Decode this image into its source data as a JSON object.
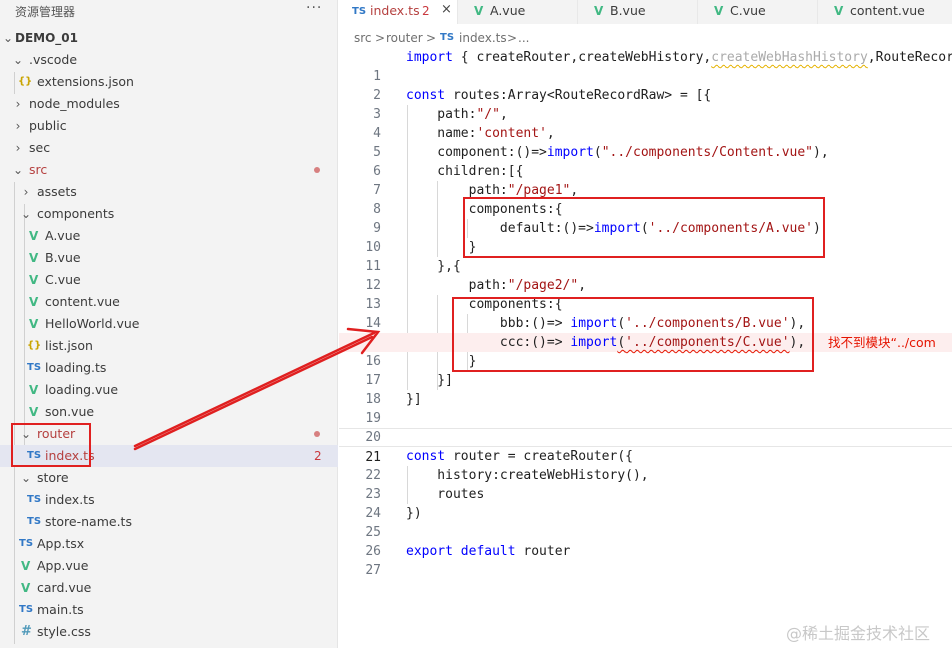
{
  "explorer": {
    "title": "资源管理器",
    "more": "···",
    "root": "DEMO_01",
    "items": [
      {
        "label": ".vscode",
        "kind": "folder-open"
      },
      {
        "label": "extensions.json",
        "kind": "json",
        "icon": "{}"
      },
      {
        "label": "node_modules",
        "kind": "folder"
      },
      {
        "label": "public",
        "kind": "folder"
      },
      {
        "label": "sec",
        "kind": "folder"
      },
      {
        "label": "src",
        "kind": "folder-open",
        "modified": true
      },
      {
        "label": "assets",
        "kind": "folder"
      },
      {
        "label": "components",
        "kind": "folder-open"
      },
      {
        "label": "A.vue",
        "kind": "vue",
        "icon": "V"
      },
      {
        "label": "B.vue",
        "kind": "vue",
        "icon": "V"
      },
      {
        "label": "C.vue",
        "kind": "vue",
        "icon": "V"
      },
      {
        "label": "content.vue",
        "kind": "vue",
        "icon": "V"
      },
      {
        "label": "HelloWorld.vue",
        "kind": "vue",
        "icon": "V"
      },
      {
        "label": "list.json",
        "kind": "json",
        "icon": "{}"
      },
      {
        "label": "loading.ts",
        "kind": "ts",
        "icon": "TS"
      },
      {
        "label": "loading.vue",
        "kind": "vue",
        "icon": "V"
      },
      {
        "label": "son.vue",
        "kind": "vue",
        "icon": "V"
      },
      {
        "label": "router",
        "kind": "folder-open",
        "modified": true
      },
      {
        "label": "index.ts",
        "kind": "ts",
        "icon": "TS",
        "badge": "2"
      },
      {
        "label": "store",
        "kind": "folder-open"
      },
      {
        "label": "index.ts",
        "kind": "ts",
        "icon": "TS"
      },
      {
        "label": "store-name.ts",
        "kind": "ts",
        "icon": "TS"
      },
      {
        "label": "App.tsx",
        "kind": "ts",
        "icon": "TS"
      },
      {
        "label": "App.vue",
        "kind": "vue",
        "icon": "V"
      },
      {
        "label": "card.vue",
        "kind": "vue",
        "icon": "V"
      },
      {
        "label": "main.ts",
        "kind": "ts",
        "icon": "TS"
      },
      {
        "label": "style.css",
        "kind": "css",
        "icon": "#"
      }
    ]
  },
  "tabs": [
    {
      "icon": "TS",
      "label": "index.ts",
      "count": "2",
      "close": "×",
      "active": true
    },
    {
      "icon": "V",
      "label": "A.vue"
    },
    {
      "icon": "V",
      "label": "B.vue"
    },
    {
      "icon": "V",
      "label": "C.vue"
    },
    {
      "icon": "V",
      "label": "content.vue"
    }
  ],
  "breadcrumb": {
    "parts": [
      "src",
      ">",
      "router",
      ">",
      "TS",
      "index.ts",
      ">",
      "..."
    ]
  },
  "code": {
    "line_numbers": [
      "1",
      "2",
      "3",
      "4",
      "5",
      "6",
      "7",
      "8",
      "9",
      "10",
      "11",
      "12",
      "13",
      "14",
      "15",
      "16",
      "17",
      "18",
      "19",
      "20",
      "21",
      "22",
      "23",
      "24",
      "25",
      "26",
      "27"
    ],
    "l1_kw": "import",
    "l1_a": " { createRouter,createWebHistory,",
    "l1_squig": "createWebHashHistory",
    "l1_b": ",RouteRecord",
    "l3_kw": "const",
    "l3_a": " routes:Array<RouteRecordRaw> = [{",
    "l4_a": "    path:",
    "l4_s": "\"/\"",
    "l4_b": ",",
    "l5_a": "    name:",
    "l5_s": "'content'",
    "l5_b": ",",
    "l6_a": "    component:()=>",
    "l6_kw": "import",
    "l6_b": "(",
    "l6_s": "\"../components/Content.vue\"",
    "l6_c": "),",
    "l7_a": "    children:[{",
    "l8_a": "        path:",
    "l8_s": "\"/page1\"",
    "l8_b": ",",
    "l9_a": "        components:{",
    "l10_a": "            default:()=>",
    "l10_kw": "import",
    "l10_b": "(",
    "l10_s": "'../components/A.vue'",
    "l10_c": ")",
    "l11_a": "        }",
    "l12_a": "    },{",
    "l13_a": "        path:",
    "l13_s": "\"/page2/\"",
    "l13_b": ",",
    "l14_a": "        components:{",
    "l15_a": "            bbb:()=> ",
    "l15_kw": "import",
    "l15_b": "(",
    "l15_s": "'../components/B.vue'",
    "l15_c": "),",
    "l16_a": "            ccc:()=> ",
    "l16_kw": "import",
    "l16_b": "(",
    "l16_s": "'../components/C.vue'",
    "l16_c": "),",
    "l16_error": "找不到模块“../com",
    "l17_a": "        }",
    "l18_a": "    }]",
    "l19_a": "}]",
    "l22_kw": "const",
    "l22_a": " router = createRouter({",
    "l23_a": "    history:createWebHistory(),",
    "l24_a": "    routes",
    "l25_a": "})",
    "l27_kw": "export default",
    "l27_a": " router"
  },
  "watermark": "@稀土掘金技术社区",
  "colors": {
    "annotation": "#e02020",
    "error": "#e51400",
    "keyword": "#0000ff",
    "string": "#a31515"
  }
}
